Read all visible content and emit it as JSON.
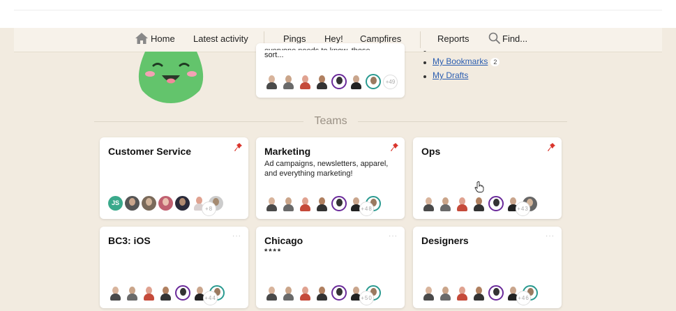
{
  "nav": {
    "home": "Home",
    "latest_activity": "Latest activity",
    "pings": "Pings",
    "hey": "Hey!",
    "campfires": "Campfires",
    "reports": "Reports",
    "find": "Find..."
  },
  "upper_card": {
    "desc_cut": "everyone needs to know, those",
    "desc": "sort...",
    "more_count": "+49"
  },
  "links": {
    "items": [
      {
        "label": "My Bookmarks",
        "badge": "2"
      },
      {
        "label": "My Drafts",
        "badge": ""
      }
    ]
  },
  "teams": {
    "heading": "Teams",
    "cards": [
      {
        "title": "Customer Service",
        "desc": "",
        "more_count": "+8"
      },
      {
        "title": "Marketing",
        "desc": "Ad campaigns, newsletters, apparel, and everything marketing!",
        "more_count": "+48"
      },
      {
        "title": "Ops",
        "desc": "",
        "more_count": "+43"
      },
      {
        "title": "BC3: iOS",
        "desc": "",
        "more_count": "+44"
      },
      {
        "title": "Chicago",
        "desc": "****",
        "more_count": "+50"
      },
      {
        "title": "Designers",
        "desc": "",
        "more_count": "+46"
      }
    ],
    "avatar_initials": "JS",
    "more_dots": "···"
  },
  "colors": {
    "background": "#f2ebe0",
    "link": "#2a5db0",
    "pin": "#d9342b",
    "mascot": "#63c46c"
  },
  "icons": [
    "home-icon",
    "search-icon",
    "pin-icon",
    "more-dots-icon",
    "pointer-cursor-icon"
  ]
}
